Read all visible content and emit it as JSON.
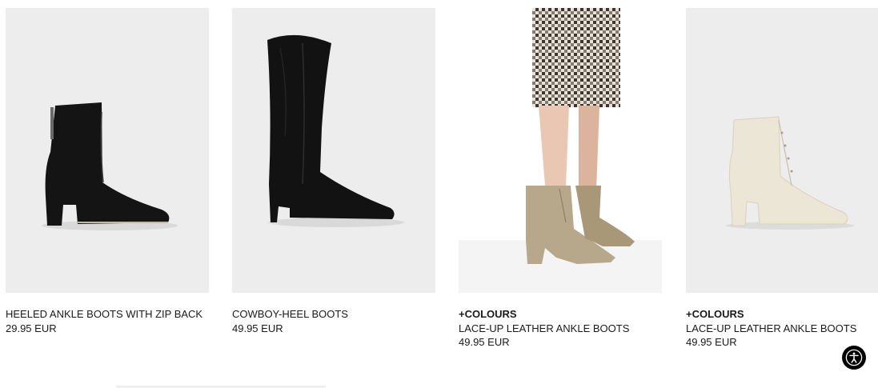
{
  "products": [
    {
      "badge": "",
      "name": "HEELED ANKLE BOOTS WITH ZIP BACK",
      "price": "29.95 EUR",
      "image": "black-heeled-ankle-boot"
    },
    {
      "badge": "",
      "name": "COWBOY-HEEL BOOTS",
      "price": "49.95 EUR",
      "image": "black-cowboy-boot"
    },
    {
      "badge": "+COLOURS",
      "name": "LACE-UP LEATHER ANKLE BOOTS",
      "price": "49.95 EUR",
      "image": "beige-lace-up-boots-worn"
    },
    {
      "badge": "+COLOURS",
      "name": "LACE-UP LEATHER ANKLE BOOTS",
      "price": "49.95 EUR",
      "image": "cream-lace-up-boot"
    }
  ],
  "accessibility_button": {
    "icon": "accessibility-icon"
  },
  "colors": {
    "background": "#ffffff",
    "photo_bg": "#ededed",
    "text": "#1a1a1a"
  }
}
